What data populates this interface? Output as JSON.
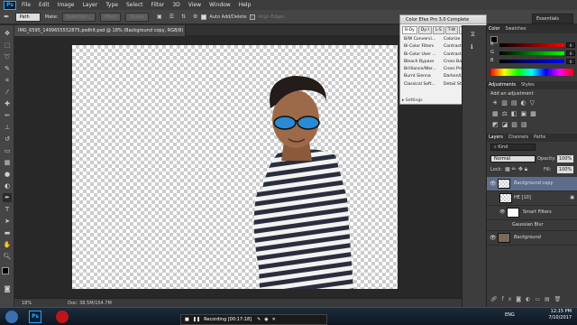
{
  "app": {
    "menu": [
      "File",
      "Edit",
      "Image",
      "Layer",
      "Type",
      "Select",
      "Filter",
      "3D",
      "View",
      "Window",
      "Help"
    ],
    "logo_text": "Ps"
  },
  "options_bar": {
    "tool_mode": "Path",
    "make_label": "Make:",
    "selection_btn": "Selection...",
    "mask_btn": "Mask",
    "shape_btn": "Shape",
    "auto_add_delete": "Auto Add/Delete",
    "align_edges": "Align Edges",
    "workspace": "Essentials"
  },
  "document": {
    "tab_title": "IMG_6595_1499655552875.psdhlt.psd @ 18% (Background copy, RGB/8) *",
    "zoom": "18%",
    "doc_size": "Doc: 38.5M/154.7M"
  },
  "color_efex": {
    "title": "Color Efex Pro 3.0 Complete",
    "tabs": [
      "B-Dy",
      "Dy-I",
      "L-S",
      "T-W",
      "Favorites"
    ],
    "filters": [
      [
        "B/W Conversi...",
        "Colorize"
      ],
      [
        "Bi-Color Filters",
        "Contrast Colo..."
      ],
      [
        "Bi-Color User ...",
        "Contrast Only"
      ],
      [
        "Bleach Bypass",
        "Cross Balance"
      ],
      [
        "Brilliance/War...",
        "Cross Proces..."
      ],
      [
        "Burnt Sienna",
        "Darken/Lighte..."
      ],
      [
        "Classical Soft...",
        "Detail Stylizer"
      ]
    ],
    "settings_label": "Settings"
  },
  "panels": {
    "top_tabs": [
      "Color",
      "Swatches"
    ],
    "color_channels": [
      {
        "label": "R",
        "value": "0"
      },
      {
        "label": "G",
        "value": "0"
      },
      {
        "label": "B",
        "value": "0"
      }
    ],
    "adjust_tabs": [
      "Adjustments",
      "Styles"
    ],
    "adjust_title": "Add an adjustment",
    "layer_tabs": [
      "Layers",
      "Channels",
      "Paths"
    ],
    "kind_label": "Kind",
    "blend_mode": "Normal",
    "opacity_label": "Opacity:",
    "opacity_value": "100%",
    "lock_label": "Lock:",
    "fill_label": "Fill:",
    "fill_value": "100%",
    "layers": [
      {
        "name": "Background copy",
        "selected": true
      },
      {
        "name": "HE [10]",
        "selected": false
      },
      {
        "name": "Smart Filters",
        "selected": false
      },
      {
        "name": "Gaussian Blur",
        "selected": false
      },
      {
        "name": "Background",
        "selected": false
      }
    ]
  },
  "taskbar": {
    "recording": "Recording [00:17:18]",
    "time": "12:15 PM",
    "date": "7/10/2017",
    "lang": "ENG"
  }
}
